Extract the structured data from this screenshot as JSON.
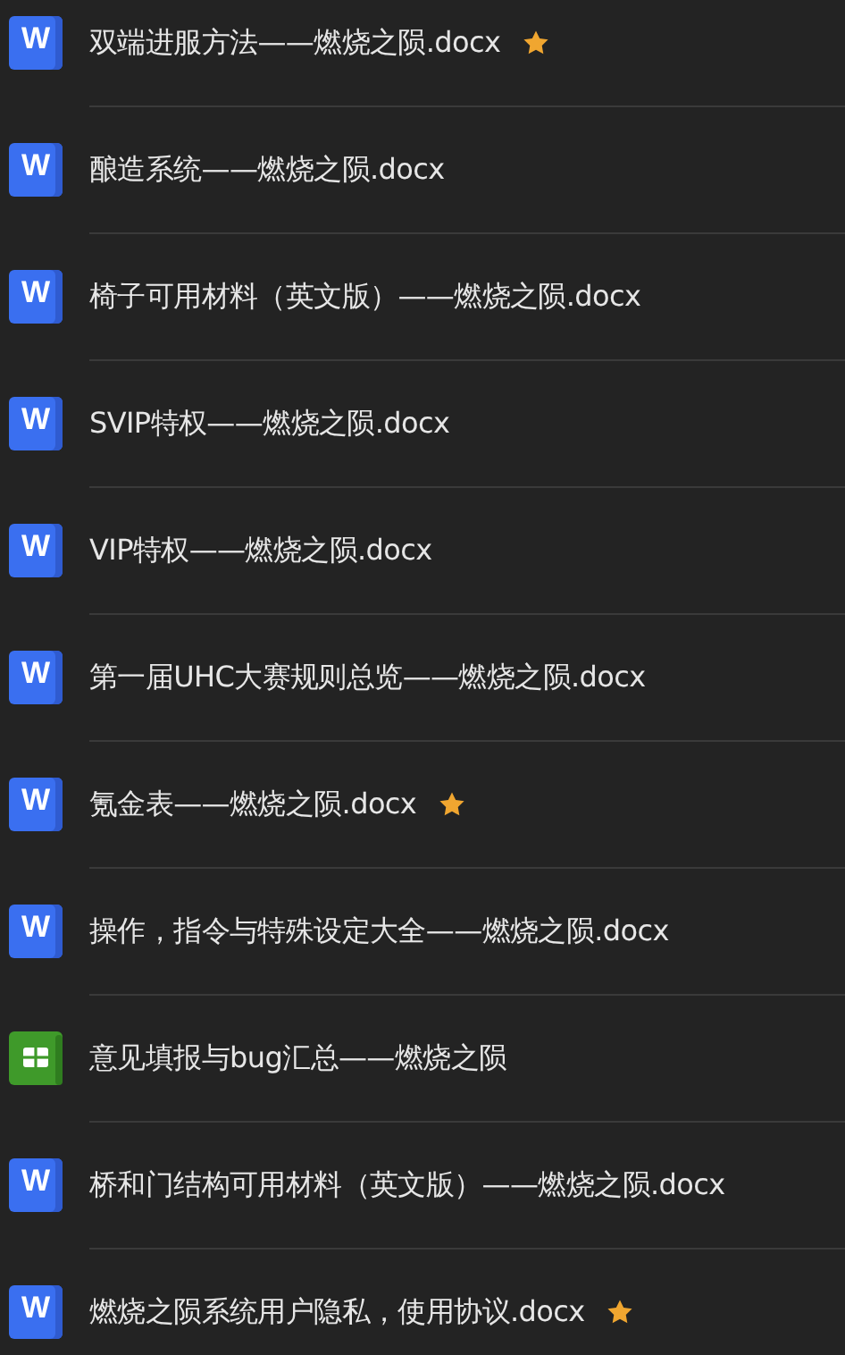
{
  "files": [
    {
      "kind": "doc",
      "icon_letter": "W",
      "name": "双端进服方法——燃烧之陨.docx",
      "starred": true
    },
    {
      "kind": "doc",
      "icon_letter": "W",
      "name": "酿造系统——燃烧之陨.docx",
      "starred": false
    },
    {
      "kind": "doc",
      "icon_letter": "W",
      "name": "椅子可用材料（英文版）——燃烧之陨.docx",
      "starred": false
    },
    {
      "kind": "doc",
      "icon_letter": "W",
      "name": "SVIP特权——燃烧之陨.docx",
      "starred": false
    },
    {
      "kind": "doc",
      "icon_letter": "W",
      "name": "VIP特权——燃烧之陨.docx",
      "starred": false
    },
    {
      "kind": "doc",
      "icon_letter": "W",
      "name": "第一届UHC大赛规则总览——燃烧之陨.docx",
      "starred": false
    },
    {
      "kind": "doc",
      "icon_letter": "W",
      "name": "氪金表——燃烧之陨.docx",
      "starred": true
    },
    {
      "kind": "doc",
      "icon_letter": "W",
      "name": "操作，指令与特殊设定大全——燃烧之陨.docx",
      "starred": false
    },
    {
      "kind": "sheet",
      "name": "意见填报与bug汇总——燃烧之陨",
      "starred": false
    },
    {
      "kind": "doc",
      "icon_letter": "W",
      "name": "桥和门结构可用材料（英文版）——燃烧之陨.docx",
      "starred": false
    },
    {
      "kind": "doc",
      "icon_letter": "W",
      "name": "燃烧之陨系统用户隐私，使用协议.docx",
      "starred": true
    }
  ]
}
